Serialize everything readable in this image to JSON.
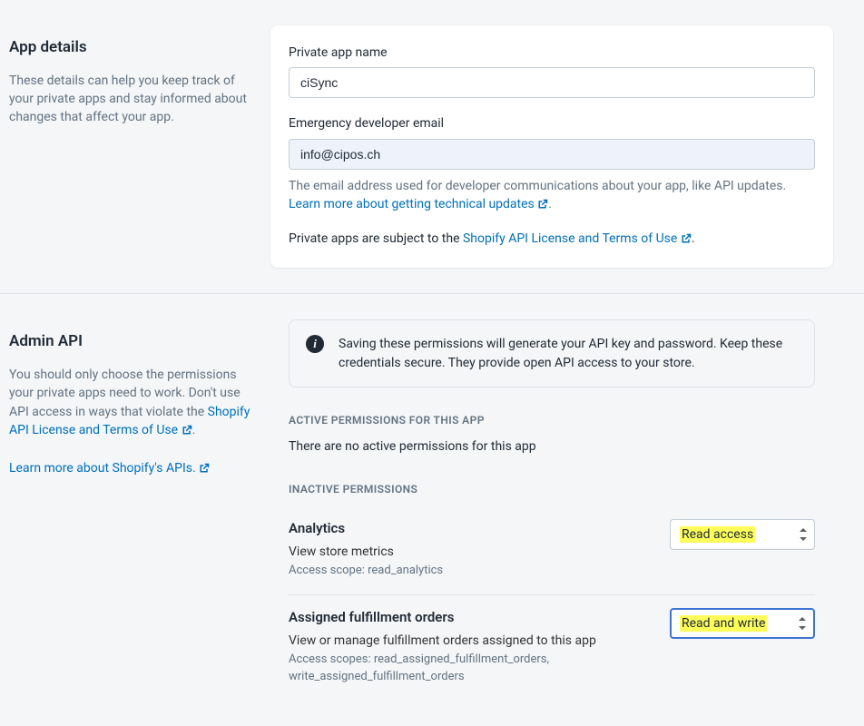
{
  "app_details": {
    "heading": "App details",
    "description": "These details can help you keep track of your private apps and stay informed about changes that affect your app.",
    "name_label": "Private app name",
    "name_value": "ciSync",
    "email_label": "Emergency developer email",
    "email_value": "info@cipos.ch",
    "email_hint_pre": "The email address used for developer communications about your app, like API updates. ",
    "email_hint_link": "Learn more about getting technical updates",
    "notice_pre": "Private apps are subject to the ",
    "notice_link": "Shopify API License and Terms of Use",
    "notice_post": "."
  },
  "admin_api": {
    "heading": "Admin API",
    "description": "You should only choose the permissions your private apps need to work. Don't use API access in ways that violate the ",
    "license_link": "Shopify API License and Terms of Use",
    "learn_apis_link": "Learn more about Shopify's APIs.",
    "banner": "Saving these permissions will generate your API key and password. Keep these credentials secure. They provide open API access to your store.",
    "active_heading": "ACTIVE PERMISSIONS FOR THIS APP",
    "active_none": "There are no active permissions for this app",
    "inactive_heading": "INACTIVE PERMISSIONS",
    "perms": [
      {
        "title": "Analytics",
        "desc": "View store metrics",
        "scope": "Access scope: read_analytics",
        "select_value": "Read access"
      },
      {
        "title": "Assigned fulfillment orders",
        "desc": "View or manage fulfillment orders assigned to this app",
        "scope": "Access scopes: read_assigned_fulfillment_orders, write_assigned_fulfillment_orders",
        "select_value": "Read and write"
      }
    ]
  }
}
